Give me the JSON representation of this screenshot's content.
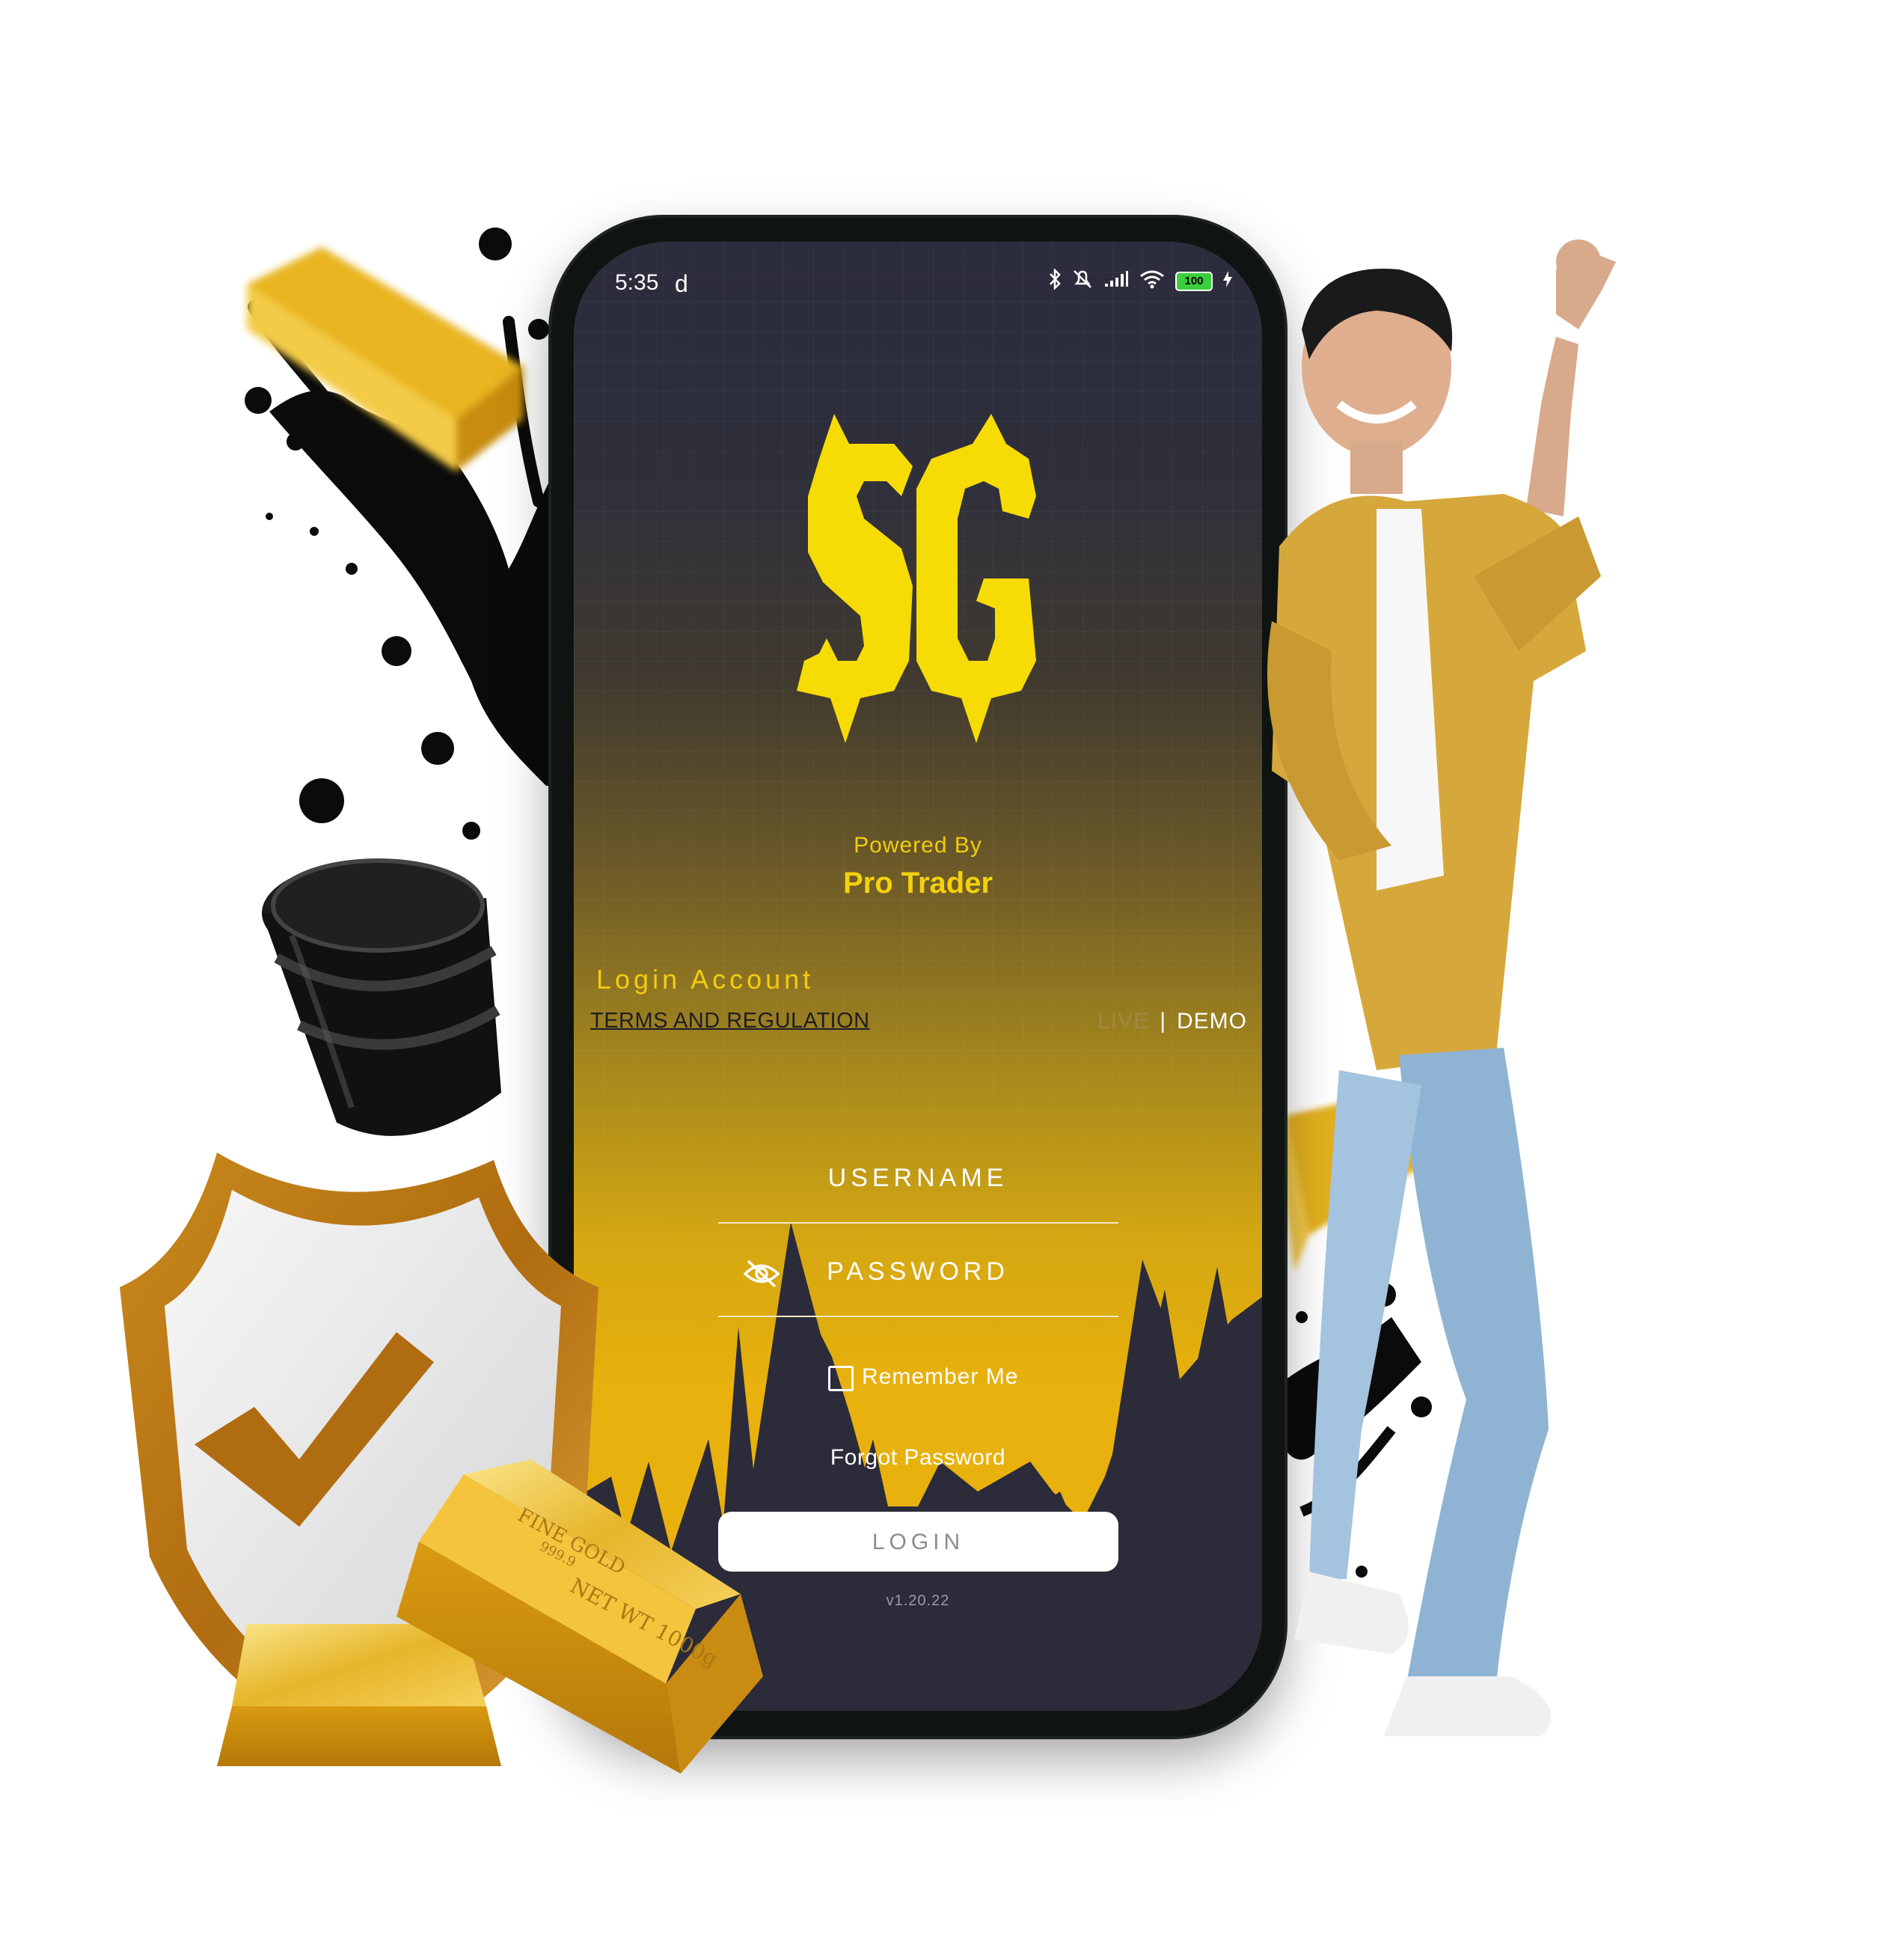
{
  "status_bar": {
    "time": "5:35",
    "indicator": "d",
    "icons": [
      "bluetooth-icon",
      "silent-bell-icon",
      "signal-icon",
      "wifi-icon"
    ],
    "battery": "100"
  },
  "brand": {
    "logo_text": "SG",
    "powered_by": "Powered By",
    "provider": "Pro Trader",
    "accent_color": "#f4d10b"
  },
  "login": {
    "title": "Login Account",
    "terms_link": "TERMS AND REGULATION",
    "mode_live": "LIVE",
    "mode_separator": "|",
    "mode_demo": "DEMO",
    "username_placeholder": "USERNAME",
    "password_placeholder": "PASSWORD",
    "remember_me": "Remember Me",
    "forgot_password": "Forgot Password",
    "login_button": "LOGIN",
    "version": "v1.20.22"
  },
  "gold_bar_text": {
    "brand": "FINE GOLD",
    "purity": "999.9",
    "weight": "NET WT 1000g"
  }
}
